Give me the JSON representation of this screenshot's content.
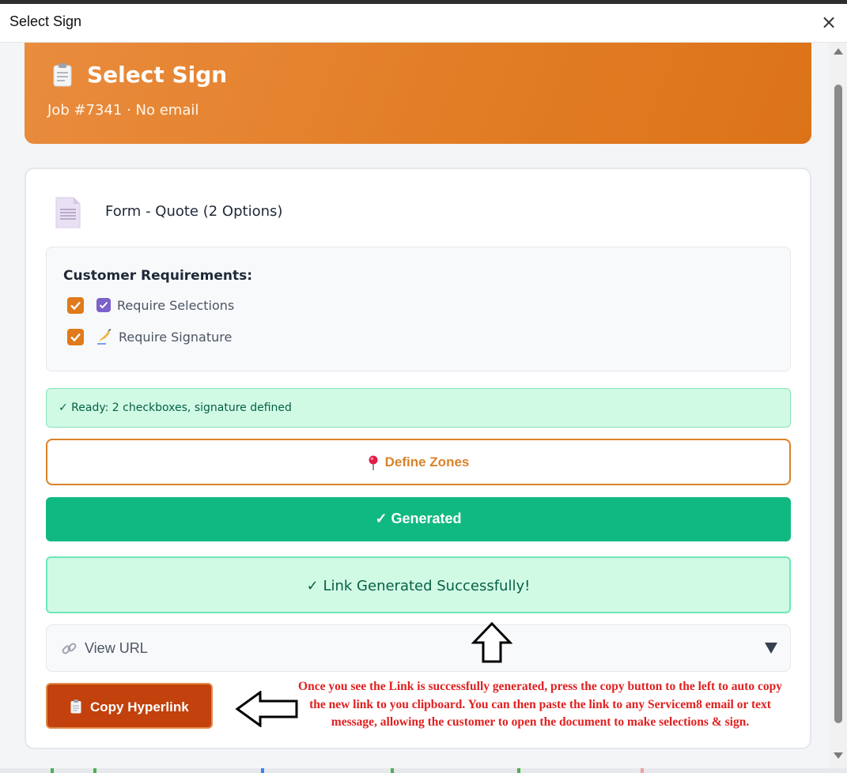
{
  "window": {
    "title": "Select Sign",
    "close_symbol": "×"
  },
  "header": {
    "icon": "clipboard-icon",
    "title": "Select Sign",
    "subtitle": "Job #7341 · No email"
  },
  "document": {
    "icon": "document-icon",
    "name": "Form - Quote (2 Options)"
  },
  "requirements": {
    "title": "Customer Requirements:",
    "items": [
      {
        "checked": true,
        "icon": "checkbox-emoji-icon",
        "label": "Require Selections"
      },
      {
        "checked": true,
        "icon": "writing-hand-icon",
        "label": "Require Signature"
      }
    ]
  },
  "status": {
    "ready_text": "✓ Ready: 2 checkboxes, signature defined"
  },
  "buttons": {
    "define_zones": "Define Zones",
    "generated": "✓ Generated",
    "copy_hyperlink": "Copy Hyperlink"
  },
  "success": {
    "text": "✓ Link Generated Successfully!"
  },
  "view_url": {
    "label": "View URL",
    "expanded": false
  },
  "annotation": {
    "note": "Once you see the Link is successfully generated, press the copy button to the left to auto copy the new link to you clipboard. You can then paste the link to any Servicem8 email or text message, allowing the customer to open the document to make selections & sign."
  },
  "colors": {
    "accent_orange": "#e27d26",
    "success_green": "#10b981",
    "copy_button": "#c2410c",
    "annotation_red": "#e02020"
  }
}
